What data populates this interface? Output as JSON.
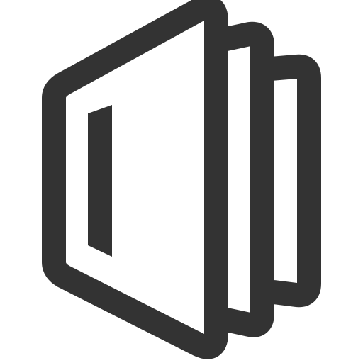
{
  "icon": {
    "name": "stacked-pages-icon",
    "stroke_color": "#333333",
    "fill_color": "#ffffff"
  }
}
